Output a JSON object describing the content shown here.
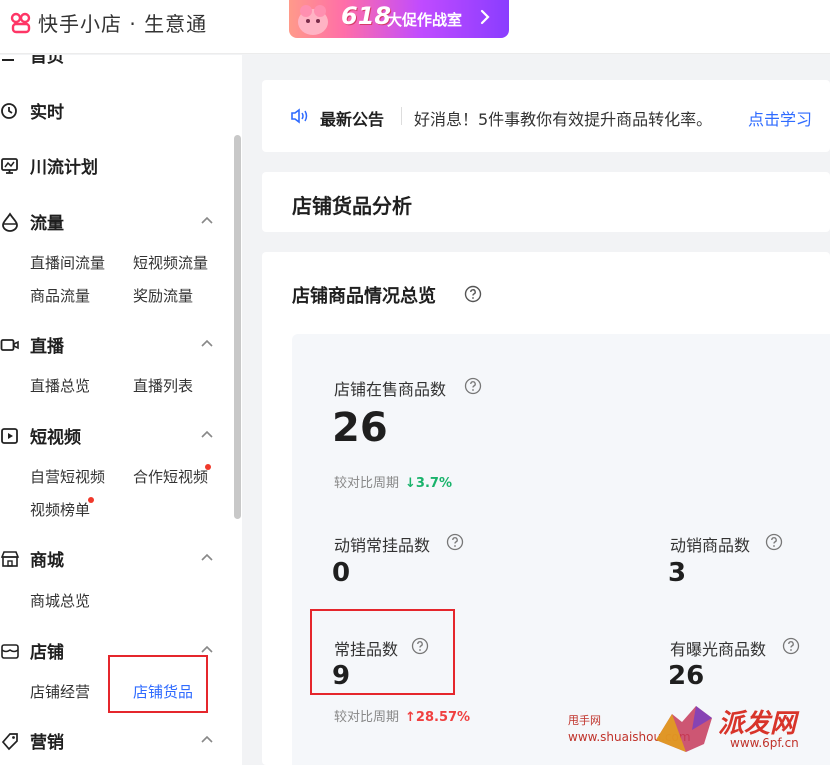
{
  "header": {
    "app_title": "快手小店 · 生意通",
    "promo_number": "618",
    "promo_text": "大促作战室"
  },
  "sidebar": {
    "items": [
      {
        "label": "首页",
        "icon": "home-icon",
        "subs": []
      },
      {
        "label": "实时",
        "icon": "clock-icon",
        "subs": []
      },
      {
        "label": "川流计划",
        "icon": "monitor-icon",
        "subs": []
      },
      {
        "label": "流量",
        "icon": "drop-icon",
        "subs": [
          "直播间流量",
          "短视频流量",
          "商品流量",
          "奖励流量"
        ]
      },
      {
        "label": "直播",
        "icon": "live-camera-icon",
        "subs": [
          "直播总览",
          "直播列表"
        ]
      },
      {
        "label": "短视频",
        "icon": "play-square-icon",
        "subs": [
          "自营短视频",
          "合作短视频",
          "视频榜单"
        ]
      },
      {
        "label": "商城",
        "icon": "shop-icon",
        "subs": [
          "商城总览"
        ]
      },
      {
        "label": "店铺",
        "icon": "store-icon",
        "subs": [
          "店铺经营",
          "店铺货品"
        ]
      },
      {
        "label": "营销",
        "icon": "tag-icon",
        "subs": []
      }
    ],
    "active_sub": "店铺货品"
  },
  "notice": {
    "label": "最新公告",
    "text": "好消息！5件事教你有效提升商品转化率。",
    "link": "点击学习"
  },
  "section_title": "店铺货品分析",
  "overview": {
    "title": "店铺商品情况总览",
    "metrics": {
      "on_sale": {
        "label": "店铺在售商品数",
        "value": "26",
        "compare_label": "较对比周期",
        "change": "↓3.7%"
      },
      "active_regular": {
        "label": "动销常挂品数",
        "value": "0"
      },
      "active_goods": {
        "label": "动销商品数",
        "value": "3"
      },
      "regular": {
        "label": "常挂品数",
        "value": "9",
        "compare_label": "较对比周期",
        "change": "↑28.57%"
      },
      "exposed": {
        "label": "有曝光商品数",
        "value": "26"
      }
    }
  },
  "watermark": {
    "site_name": "甩手网",
    "site_url": "www.shuaishou.com",
    "brand": "派发网",
    "brand_url": "www.6pf.cn"
  },
  "colors": {
    "accent_blue": "#2f6bff",
    "highlight_red": "#e5262c",
    "down_green": "#19b36b",
    "up_red": "#f04040"
  }
}
